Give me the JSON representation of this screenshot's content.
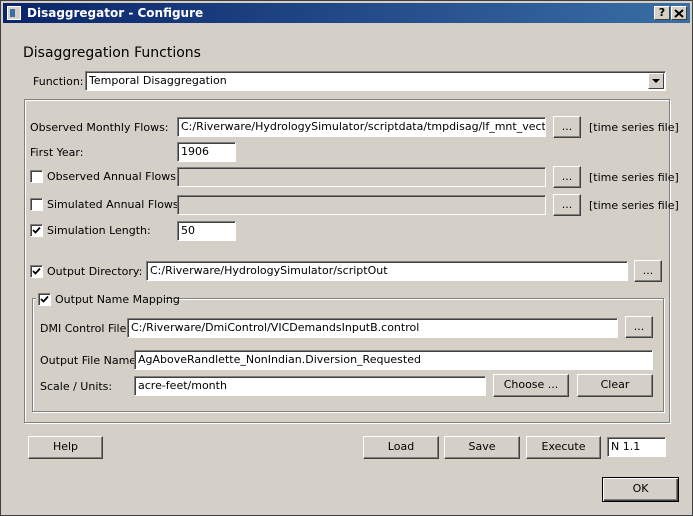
{
  "window": {
    "title": "Disaggregator - Configure",
    "help_button": "?",
    "close_button": "X"
  },
  "section_title": "Disaggregation Functions",
  "function": {
    "label": "Function:",
    "value": "Temporal Disaggregation"
  },
  "observed_monthly": {
    "label": "Observed Monthly Flows:",
    "value": "C:/Riverware/HydrologySimulator/scriptdata/tmpdisag/lf_mnt_vector.txt",
    "browse": "...",
    "type": "[time series file]"
  },
  "first_year": {
    "label": "First Year:",
    "value": "1906"
  },
  "observed_annual": {
    "label": "Observed Annual Flows:",
    "checked": false,
    "value": "",
    "browse": "...",
    "type": "[time series file]"
  },
  "simulated_annual": {
    "label": "Simulated Annual Flows:",
    "checked": false,
    "value": "",
    "browse": "...",
    "type": "[time series file]"
  },
  "simulation_length": {
    "label": "Simulation Length:",
    "checked": true,
    "value": "50"
  },
  "output_directory": {
    "label": "Output Directory:",
    "checked": true,
    "value": "C:/Riverware/HydrologySimulator/scriptOut",
    "browse": "..."
  },
  "output_name_mapping": {
    "label": "Output Name Mapping",
    "checked": true,
    "dmi_control": {
      "label": "DMI Control File:",
      "value": "C:/Riverware/DmiControl/VICDemandsInputB.control",
      "browse": "..."
    },
    "output_file_name": {
      "label": "Output File Name:",
      "value": "AgAboveRandlette_NonIndian.Diversion_Requested"
    },
    "scale_units": {
      "label": "Scale / Units:",
      "value": "acre-feet/month",
      "choose": "Choose ...",
      "clear": "Clear"
    }
  },
  "footer": {
    "help": "Help",
    "load": "Load",
    "save": "Save",
    "execute": "Execute",
    "version": "N 1.1",
    "ok": "OK"
  }
}
